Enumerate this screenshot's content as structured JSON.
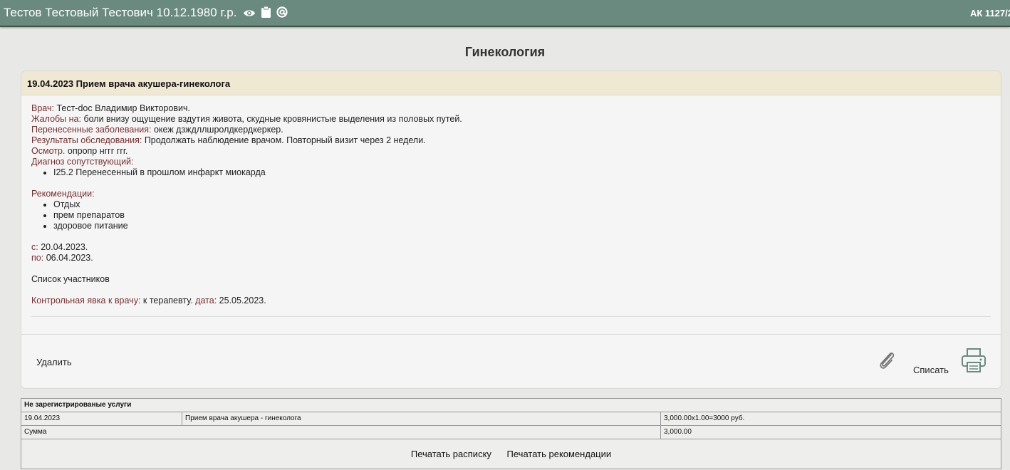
{
  "topbar": {
    "patient": "Тестов Тестовый Тестович 10.12.1980 г.р.",
    "card_number": "АК 1127/2",
    "icons": [
      "eye-icon",
      "clipboard-icon",
      "at-icon"
    ],
    "background": "#6a8a80"
  },
  "page": {
    "title": "Гинекология"
  },
  "visit": {
    "header": "19.04.2023 Прием врача акушера-гинеколога",
    "doctor_label": "Врач:",
    "doctor": "Тест-doc Владимир Викторович.",
    "complaints_label": "Жалобы на:",
    "complaints": "боли внизу ощущение вздутия живота, скудные кровянистые выделения из половых путей.",
    "past_diseases_label": "Перенесенные заболевания:",
    "past_diseases": "океж дзждллшролдкердкеркер.",
    "results_label": "Результаты обследования:",
    "results": "Продолжать наблюдение врачом. Повторный визит через 2 недели.",
    "exam_label": "Осмотр.",
    "exam": "опропр нггг ггг.",
    "concomitant_label": "Диагноз сопутствующий:",
    "concomitant": [
      "I25.2 Перенесенный в прошлом инфаркт миокарда"
    ],
    "recommendations_label": "Рекомендации:",
    "recommendations": [
      "Отдых",
      "прем препаратов",
      "здоровое питание"
    ],
    "from_label": "с:",
    "from": "20.04.2023.",
    "to_label": "по:",
    "to": "06.04.2023.",
    "participants": "Список участников",
    "control_label": "Контрольная явка к врачу:",
    "control_to": "к терапевту.",
    "control_date_label": "дата:",
    "control_date": "25.05.2023.",
    "label_color": "#7a2e2e"
  },
  "footer": {
    "delete": "Удалить",
    "write_off": "Списать",
    "icons": [
      "paperclip-icon",
      "printer-icon"
    ]
  },
  "services": {
    "header": "Не зарегистрированые услуги",
    "rows": [
      {
        "date": "19.04.2023",
        "name": "Прием врача акушера - гинеколога",
        "price": "3,000.00x1.00=3000 руб."
      }
    ],
    "sum_label": "Сумма",
    "sum_value": "3,000.00",
    "print_receipt": "Печатать расписку",
    "print_recommendations": "Печатать рекомендации"
  }
}
